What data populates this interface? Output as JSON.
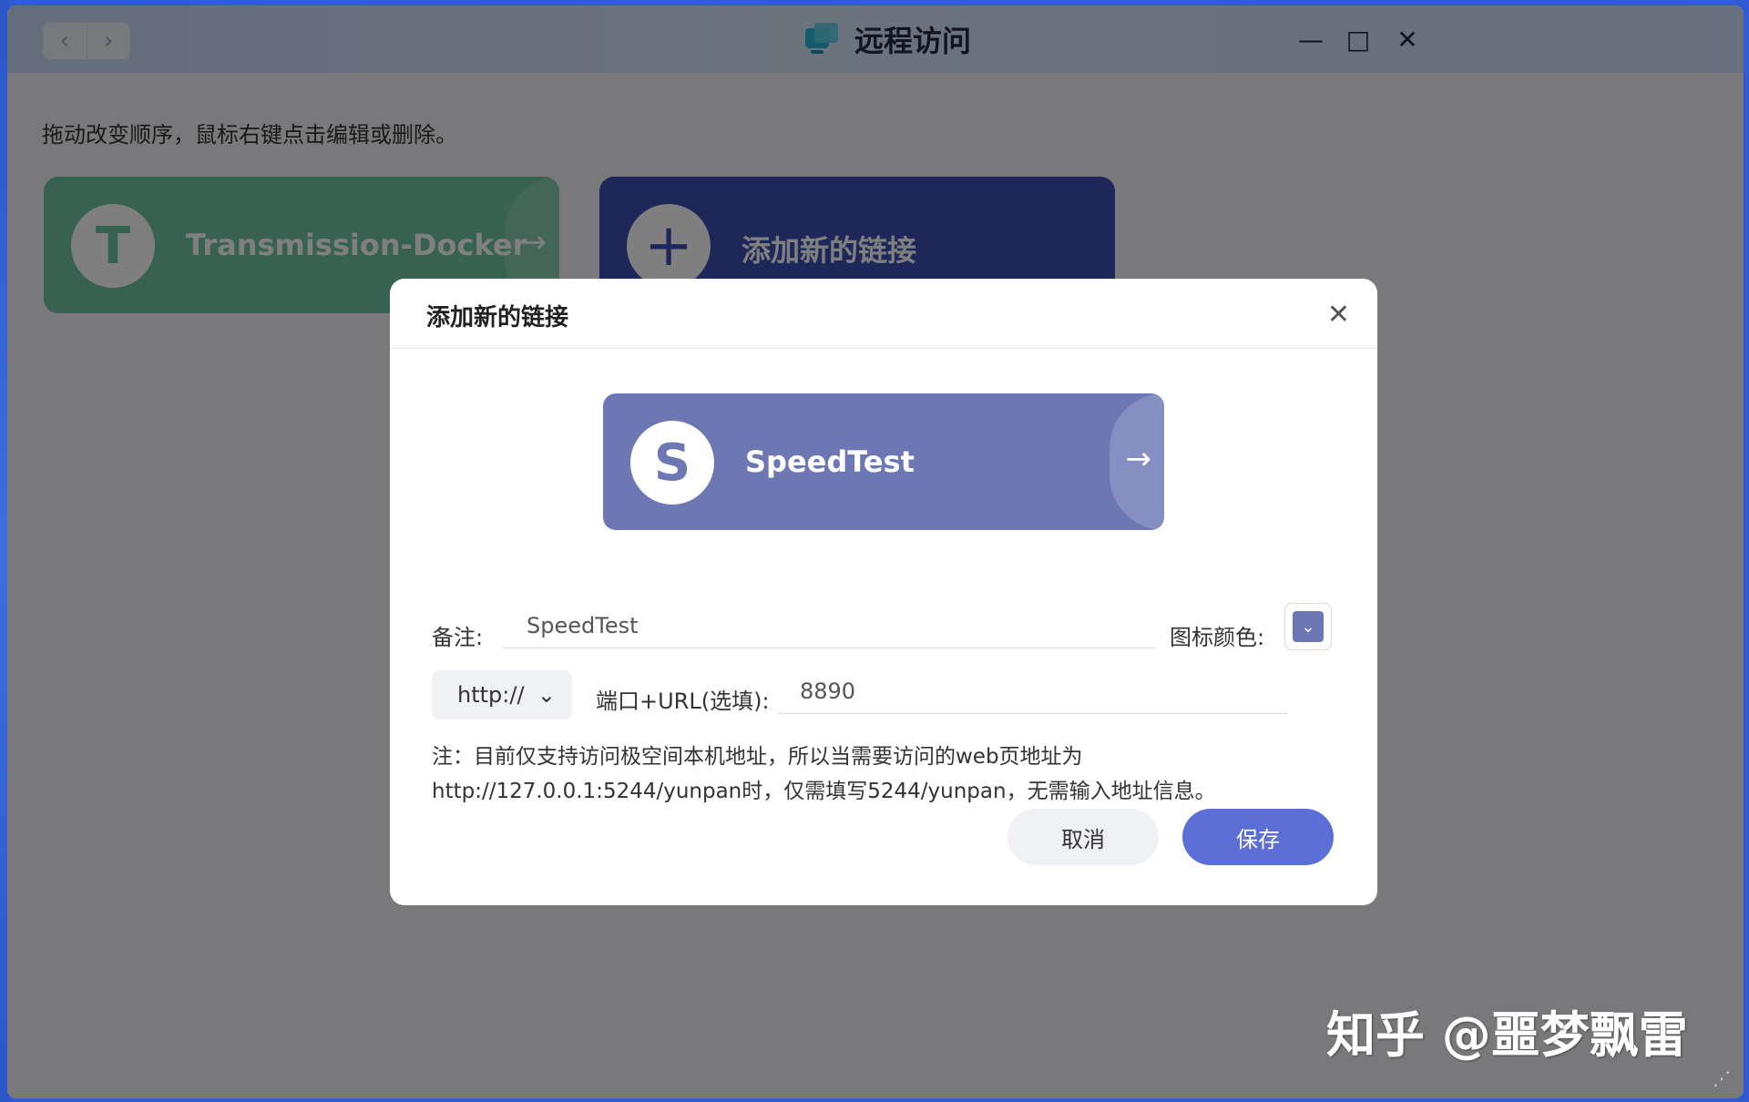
{
  "window": {
    "title": "远程访问",
    "back_glyph": "‹",
    "forward_glyph": "›",
    "minimize_glyph": "—",
    "maximize_glyph": "□",
    "close_glyph": "✕"
  },
  "main": {
    "hint": "拖动改变顺序，鼠标右键点击编辑或删除。",
    "tiles": [
      {
        "letter": "T",
        "label": "Transmission-Docker",
        "color": "#6fc3a0"
      },
      {
        "letter": "+",
        "label": "添加新的链接",
        "color": "#3a4fb2"
      }
    ],
    "arrow_glyph": "→"
  },
  "dialog": {
    "title": "添加新的链接",
    "close_glyph": "✕",
    "preview": {
      "letter": "S",
      "label": "SpeedTest",
      "color": "#6c77b4"
    },
    "remark_label": "备注:",
    "remark_value": "SpeedTest",
    "icon_color_label": "图标颜色:",
    "icon_color": "#6c77b4",
    "protocol": "http://",
    "port_label": "端口+URL(选填):",
    "port_value": "8890",
    "note": "注：目前仅支持访问极空间本机地址，所以当需要访问的web页地址为http://127.0.0.1:5244/yunpan时，仅需填写5244/yunpan，无需输入地址信息。",
    "cancel_label": "取消",
    "save_label": "保存"
  },
  "watermark": "知乎 @噩梦飘雷"
}
